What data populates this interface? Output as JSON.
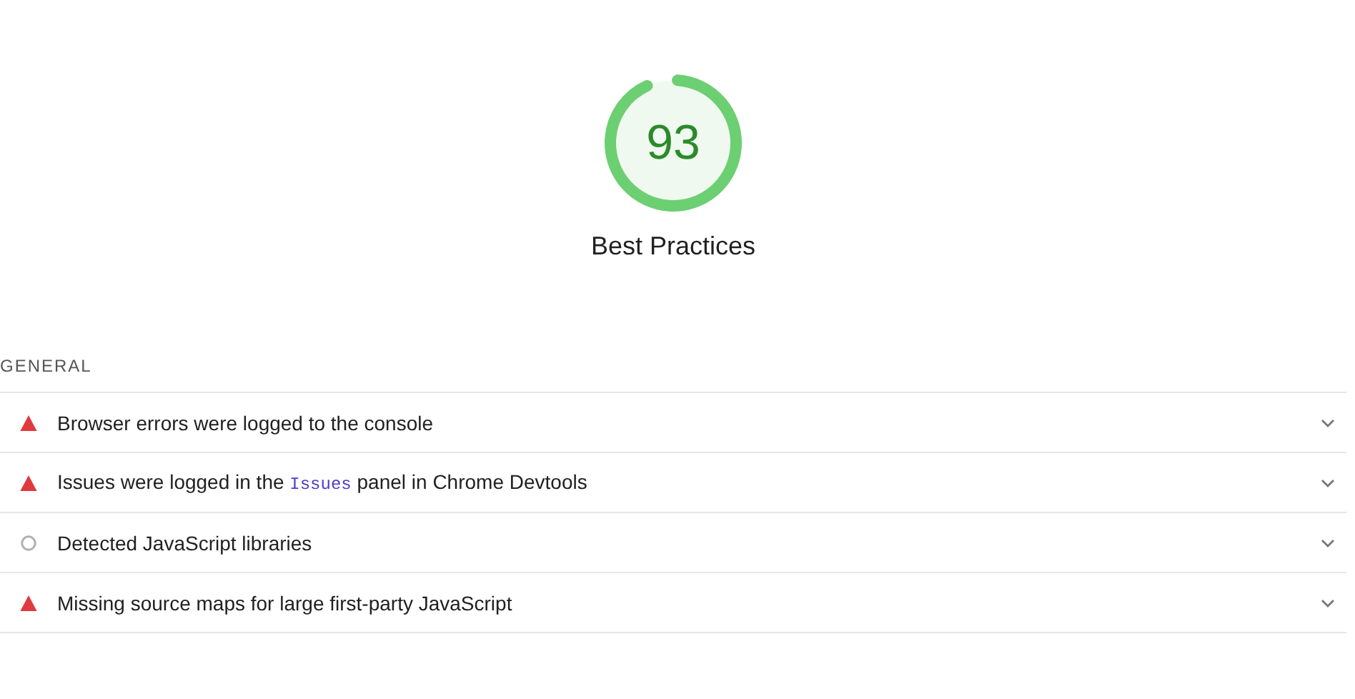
{
  "gauge": {
    "score": "93",
    "title": "Best Practices"
  },
  "group": {
    "title": "GENERAL"
  },
  "audits": [
    {
      "kind": "fail",
      "expanded": false,
      "parts": [
        {
          "text": "Browser errors were logged to the console"
        }
      ]
    },
    {
      "kind": "fail",
      "expanded": false,
      "parts": [
        {
          "text": "Issues were logged in the "
        },
        {
          "text": "Issues",
          "kind": "code"
        },
        {
          "text": " panel in Chrome Devtools"
        }
      ]
    },
    {
      "kind": "info",
      "expanded": false,
      "parts": [
        {
          "text": "Detected JavaScript libraries"
        }
      ]
    },
    {
      "kind": "fail",
      "expanded": false,
      "parts": [
        {
          "text": "Missing source maps for large first-party JavaScript"
        }
      ]
    }
  ]
}
